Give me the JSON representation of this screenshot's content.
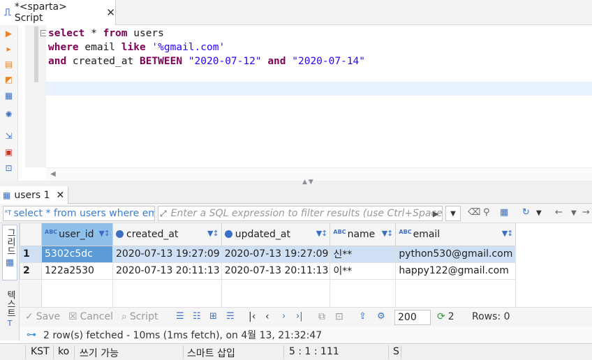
{
  "editor_tab": {
    "title": "*<sparta> Script"
  },
  "sql": {
    "line1": {
      "kw1": "select",
      "plain1": " * ",
      "kw2": "from",
      "plain2": " users"
    },
    "line2": {
      "kw1": "where",
      "plain1": " email ",
      "kw2": "like",
      "plain2": " ",
      "str1": "'%gmail.com'"
    },
    "line3": {
      "kw1": "and",
      "plain1": " created_at ",
      "kw2": "BETWEEN",
      "plain2": " ",
      "str1": "\"2020-07-12\"",
      "plain3": " ",
      "kw3": "and",
      "plain4": " ",
      "str2": "\"2020-07-14\""
    }
  },
  "results_tab": {
    "label": "users 1"
  },
  "filter": {
    "query_label": "select * from users where em",
    "placeholder": "Enter a SQL expression to filter results (use Ctrl+Space)"
  },
  "side_tabs": {
    "grid": "그리드",
    "text": "텍스트"
  },
  "grid": {
    "columns": [
      {
        "type": "ABC",
        "name": "user_id"
      },
      {
        "type": "clock",
        "name": "created_at"
      },
      {
        "type": "clock",
        "name": "updated_at"
      },
      {
        "type": "ABC",
        "name": "name"
      },
      {
        "type": "ABC",
        "name": "email"
      }
    ],
    "rows": [
      {
        "num": "1",
        "user_id": "5302c5dc",
        "created_at": "2020-07-13 19:27:09",
        "updated_at": "2020-07-13 19:27:09",
        "name": "신**",
        "email": "python530@gmail.com"
      },
      {
        "num": "2",
        "user_id": "122a2530",
        "created_at": "2020-07-13 20:11:13",
        "updated_at": "2020-07-13 20:11:13",
        "name": "이**",
        "email": "happy122@gmail.com"
      }
    ]
  },
  "bottom_toolbar": {
    "save": "Save",
    "cancel": "Cancel",
    "script": "Script",
    "fetch_size": "200",
    "refresh_count": "2",
    "rows_label": "Rows: 0"
  },
  "status_message": "2 row(s) fetched - 10ms (1ms fetch), on 4월 13, 21:32:47",
  "statusbar": {
    "timezone": "KST",
    "locale": "ko",
    "mode": "쓰기 가능",
    "insert_mode": "스마트 삽입",
    "cursor": "5 : 1 : 111",
    "extra": "S"
  },
  "colors": {
    "keyword": "#7f0055",
    "string": "#2a00ff",
    "accent": "#3a6fc4",
    "selection": "#5b9bd5"
  },
  "icons": [
    "script-tab-icon",
    "execute-icon",
    "execute-script-icon",
    "explain-icon",
    "load-plan-icon",
    "open-icon",
    "settings-icon",
    "export-icon",
    "import-icon",
    "table-grid-icon",
    "filter-icon",
    "refresh-icon",
    "gear-icon"
  ]
}
